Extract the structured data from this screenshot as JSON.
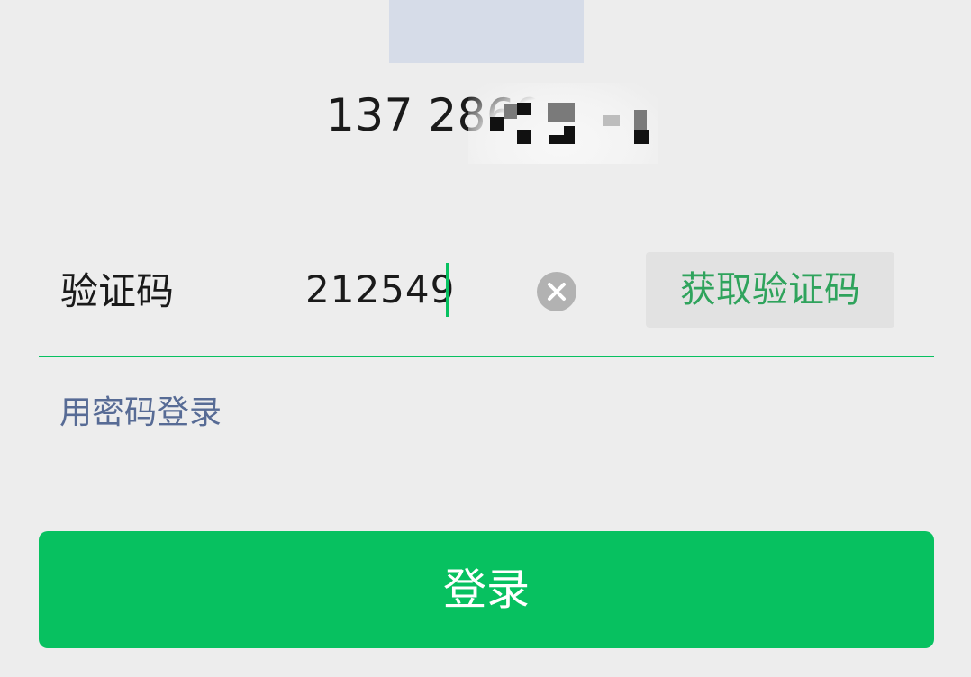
{
  "account": {
    "phone_number_visible": "137 2869"
  },
  "code_field": {
    "label": "验证码",
    "value": "212549",
    "clear_icon": "close-circle-icon",
    "get_code_label": "获取验证码"
  },
  "links": {
    "password_login": "用密码登录"
  },
  "actions": {
    "login_label": "登录"
  },
  "colors": {
    "accent": "#07c160",
    "link": "#576b95",
    "get_code_text": "#2fa35c",
    "background": "#ededed"
  }
}
